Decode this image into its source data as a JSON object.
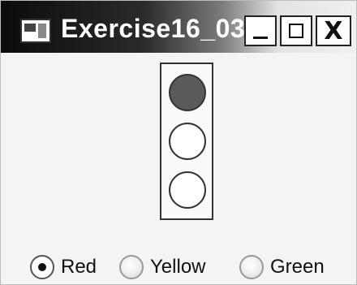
{
  "window": {
    "title": "Exercise16_03",
    "close_label": "X"
  },
  "traffic_light": {
    "lamps": [
      {
        "name": "top",
        "state": "on"
      },
      {
        "name": "middle",
        "state": "off"
      },
      {
        "name": "bottom",
        "state": "off"
      }
    ],
    "lamp_on_color": "#5a5a5a",
    "lamp_off_color": "#ffffff"
  },
  "radio_group": {
    "selected": "Red",
    "options": [
      {
        "label": "Red"
      },
      {
        "label": "Yellow"
      },
      {
        "label": "Green"
      }
    ]
  }
}
